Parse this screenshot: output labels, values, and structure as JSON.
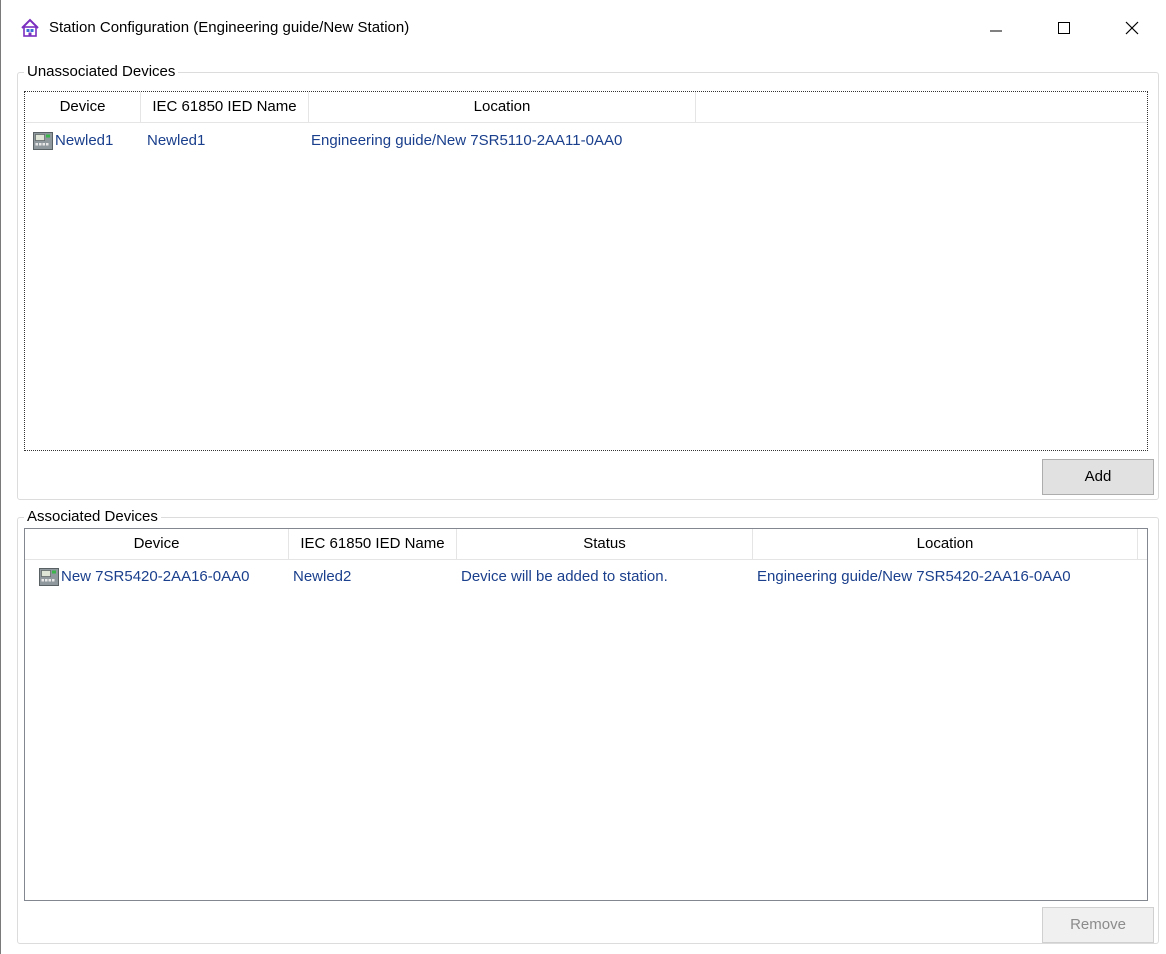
{
  "window": {
    "title": "Station Configuration (Engineering guide/New Station)",
    "icon": "house-icon",
    "controls": {
      "minimize": "minimize-icon",
      "maximize": "maximize-icon",
      "close": "close-icon"
    }
  },
  "unassociated": {
    "legend": "Unassociated Devices",
    "columns": [
      "Device",
      "IEC 61850 IED Name",
      "Location"
    ],
    "rows": [
      {
        "device": "Newled1",
        "ied_name": "Newled1",
        "location": "Engineering guide/New 7SR5110-2AA11-0AA0"
      }
    ],
    "button_label": "Add"
  },
  "associated": {
    "legend": "Associated Devices",
    "columns": [
      "Device",
      "IEC 61850 IED Name",
      "Status",
      "Location"
    ],
    "rows": [
      {
        "device": "New 7SR5420-2AA16-0AA0",
        "ied_name": "Newled2",
        "status": "Device will be added to station.",
        "location": "Engineering guide/New 7SR5420-2AA16-0AA0"
      }
    ],
    "button_label": "Remove"
  },
  "colors": {
    "link_text": "#1a3f8c",
    "disabled_text": "#8c8c8c",
    "accent_icon": "#7b2fbf"
  }
}
